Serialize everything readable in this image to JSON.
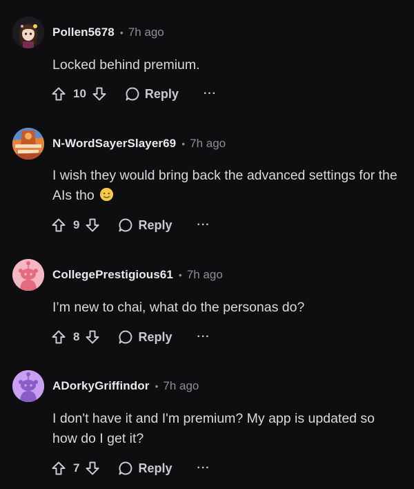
{
  "comments": [
    {
      "username": "Pollen5678",
      "separator": "•",
      "time": "7h ago",
      "body": "Locked behind premium.",
      "score": "10",
      "reply_label": "Reply",
      "more_label": "···",
      "avatar_icon": "anime-character-avatar"
    },
    {
      "username": "N-WordSayerSlayer69",
      "separator": "•",
      "time": "7h ago",
      "body": "I wish they would bring back the advanced settings for the AIs tho",
      "body_emoji": "slightly-smiling-tear-face-emoji",
      "score": "9",
      "reply_label": "Reply",
      "more_label": "···",
      "avatar_icon": "colorful-image-avatar"
    },
    {
      "username": "CollegePrestigious61",
      "separator": "•",
      "time": "7h ago",
      "body": "I’m new to chai, what do the personas do?",
      "score": "8",
      "reply_label": "Reply",
      "more_label": "···",
      "avatar_icon": "snoo-default-avatar-pink"
    },
    {
      "username": "ADorkyGriffindor",
      "separator": "•",
      "time": "7h ago",
      "body": "I don't have it and I'm premium? My app is updated so how do I get it?",
      "score": "7",
      "reply_label": "Reply",
      "more_label": "···",
      "avatar_icon": "snoo-default-avatar-purple"
    }
  ],
  "colors": {
    "background": "#0e0e10",
    "text": "#d7dadc",
    "muted": "#8b8e93",
    "snoo_pink_bg": "#f2b7c2",
    "snoo_purple_bg": "#c9a0f0"
  }
}
